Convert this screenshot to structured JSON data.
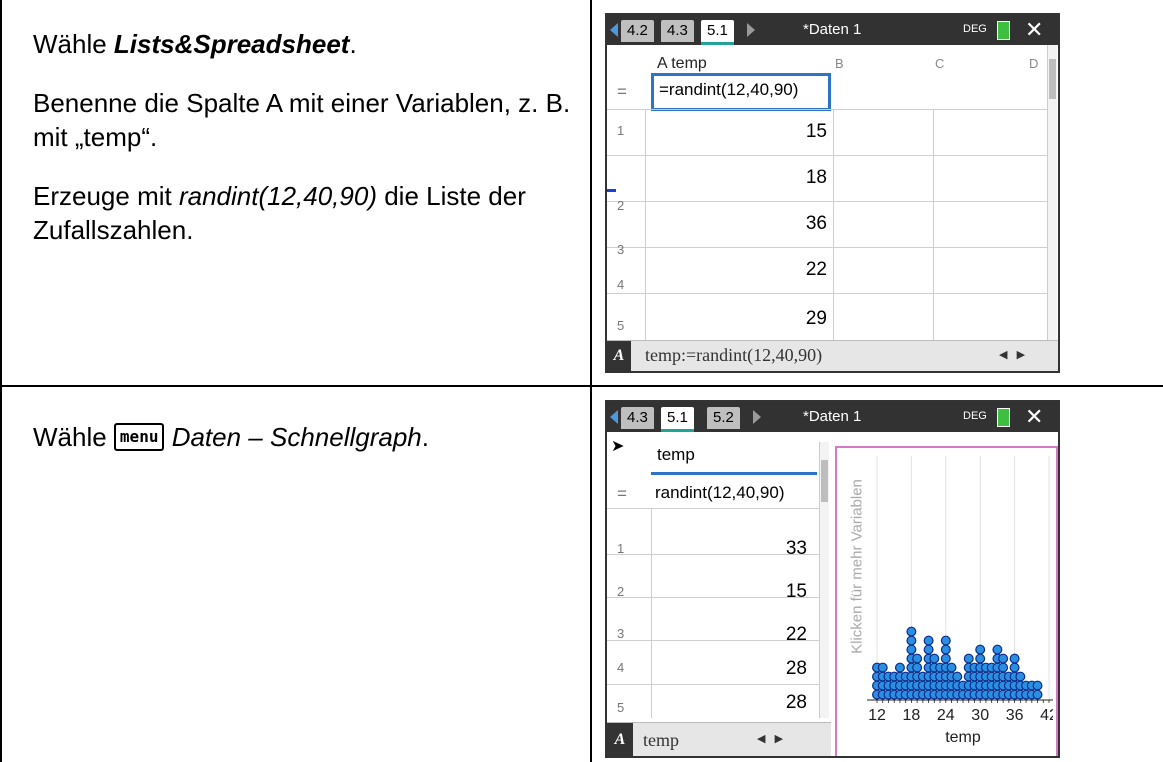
{
  "row1": {
    "instruction": {
      "prefix": "Wähle ",
      "app": "Lists&Spreadsheet",
      "suffix": ".",
      "p2": "Benenne die Spalte A mit einer Variablen, z. B. mit „temp“.",
      "p3_prefix": "Erzeuge mit ",
      "p3_cmd": "randint(12,40,90)",
      "p3_suffix": " die Liste der Zufallszahlen."
    },
    "screen": {
      "tabs": [
        "4.2",
        "4.3",
        "5.1"
      ],
      "active_tab": "5.1",
      "doc_title": "*Daten 1",
      "mode": "DEG",
      "col_headers": [
        "A temp",
        "B",
        "C",
        "D"
      ],
      "formula_row": {
        "marker": "=",
        "value": "=randint(12,40,90)"
      },
      "rows": [
        {
          "n": "1",
          "v": "15"
        },
        {
          "n": "2",
          "v": "18"
        },
        {
          "n": "3",
          "v": "36"
        },
        {
          "n": "4",
          "v": "22"
        },
        {
          "n": "5",
          "v": "29"
        }
      ],
      "status": {
        "cell": "A",
        "formula": "temp:=randint(12,40,90)"
      }
    }
  },
  "row2": {
    "instruction": {
      "prefix": "Wähle ",
      "key": "menu",
      "rest": "Daten – Schnellgraph",
      "suffix": "."
    },
    "screen": {
      "tabs": [
        "4.3",
        "5.1",
        "5.2"
      ],
      "active_tab": "5.1",
      "doc_title": "*Daten 1",
      "mode": "DEG",
      "col_header": "temp",
      "formula_row": {
        "marker": "=",
        "value": "randint(12,40,90)"
      },
      "rows": [
        {
          "n": "1",
          "v": "33"
        },
        {
          "n": "2",
          "v": "15"
        },
        {
          "n": "3",
          "v": "22"
        },
        {
          "n": "4",
          "v": "28"
        },
        {
          "n": "5",
          "v": "28"
        }
      ],
      "status": {
        "cell": "A",
        "name": "temp"
      },
      "plot_hint": "Klicken für mehr Variablen"
    }
  },
  "chart_data": {
    "type": "scatter",
    "title": "",
    "xlabel": "temp",
    "ylabel": "",
    "x_tick_labels": [
      "12",
      "18",
      "24",
      "30",
      "36",
      "42"
    ],
    "xlim": [
      12,
      42
    ],
    "marker_color": "#2a8fe0",
    "marker_edge": "#0b2a8a",
    "dot_counts": [
      {
        "x": 12,
        "count": 4
      },
      {
        "x": 13,
        "count": 4
      },
      {
        "x": 14,
        "count": 3
      },
      {
        "x": 15,
        "count": 3
      },
      {
        "x": 16,
        "count": 4
      },
      {
        "x": 17,
        "count": 3
      },
      {
        "x": 18,
        "count": 8
      },
      {
        "x": 19,
        "count": 5
      },
      {
        "x": 20,
        "count": 3
      },
      {
        "x": 21,
        "count": 7
      },
      {
        "x": 22,
        "count": 5
      },
      {
        "x": 23,
        "count": 4
      },
      {
        "x": 24,
        "count": 7
      },
      {
        "x": 25,
        "count": 4
      },
      {
        "x": 26,
        "count": 3
      },
      {
        "x": 27,
        "count": 2
      },
      {
        "x": 28,
        "count": 5
      },
      {
        "x": 29,
        "count": 4
      },
      {
        "x": 30,
        "count": 6
      },
      {
        "x": 31,
        "count": 4
      },
      {
        "x": 32,
        "count": 4
      },
      {
        "x": 33,
        "count": 6
      },
      {
        "x": 34,
        "count": 5
      },
      {
        "x": 35,
        "count": 3
      },
      {
        "x": 36,
        "count": 5
      },
      {
        "x": 37,
        "count": 3
      },
      {
        "x": 38,
        "count": 2
      },
      {
        "x": 39,
        "count": 2
      },
      {
        "x": 40,
        "count": 2
      }
    ]
  }
}
